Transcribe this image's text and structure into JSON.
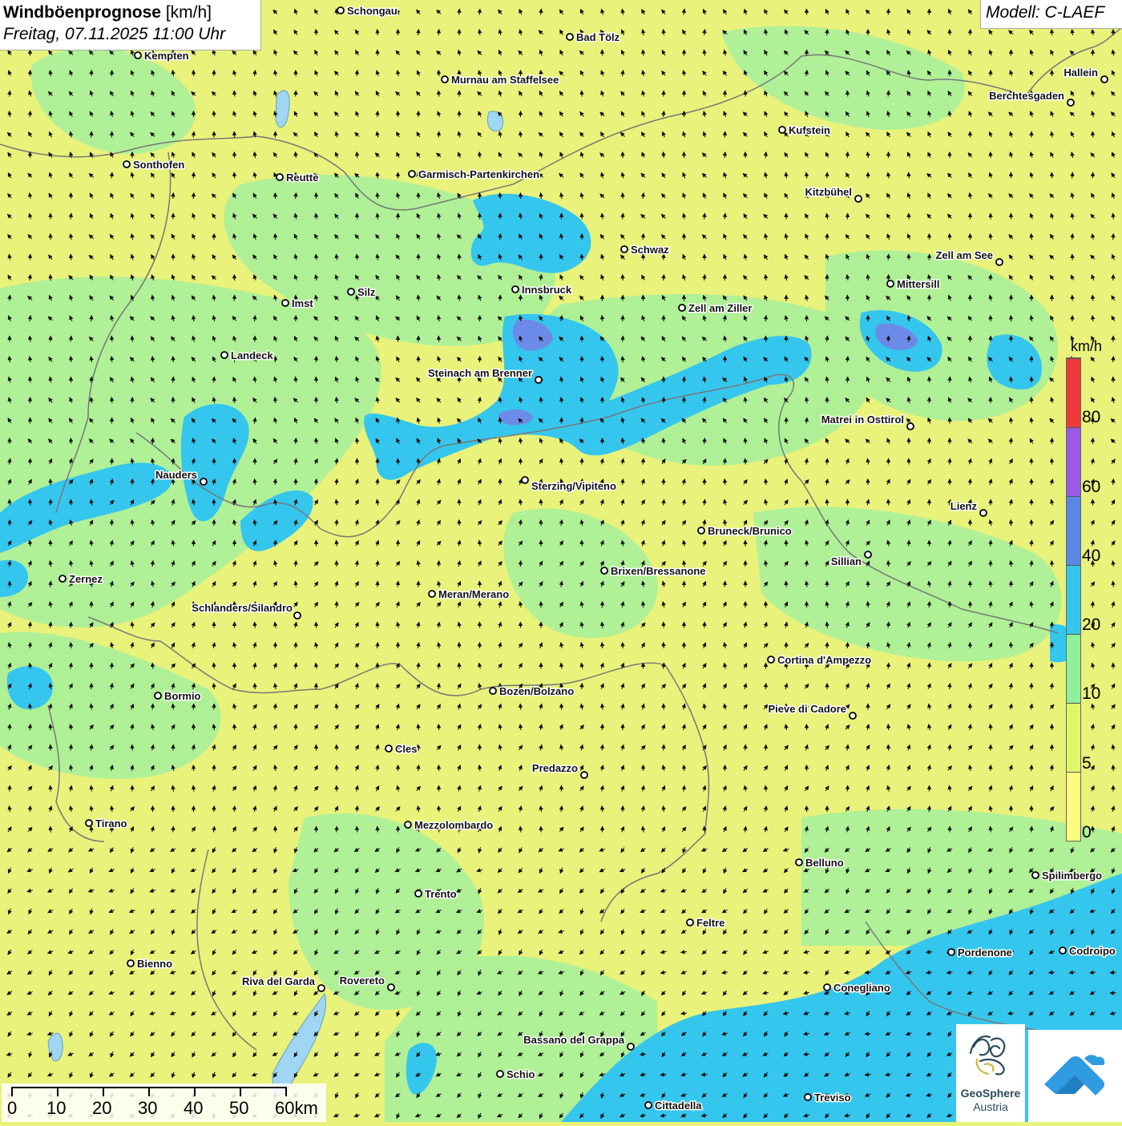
{
  "header": {
    "title": "Windböenprognose",
    "unit": "[km/h]",
    "datetime": "Freitag, 07.11.2025 11:00 Uhr",
    "model": "Modell: C-LAEF"
  },
  "legend": {
    "unit": "km/h",
    "classes": [
      {
        "color": "#fdfb80",
        "from": 0
      },
      {
        "color": "#e1f56a",
        "from": 5
      },
      {
        "color": "#8ef09a",
        "from": 10
      },
      {
        "color": "#35c6ee",
        "from": 20
      },
      {
        "color": "#5a86e6",
        "from": 40
      },
      {
        "color": "#9a5ae6",
        "from": 60
      },
      {
        "color": "#ee3a3a",
        "from": 80
      }
    ],
    "tick_labels": [
      "0",
      "5",
      "10",
      "20",
      "40",
      "60",
      "80"
    ]
  },
  "scale_bar": {
    "labels": [
      "0",
      "10",
      "20",
      "30",
      "40",
      "50",
      "60km"
    ]
  },
  "cities": [
    {
      "name": "Schongau"
    },
    {
      "name": "Bad Tölz"
    },
    {
      "name": "Kempten"
    },
    {
      "name": "Murnau am Staffelsee"
    },
    {
      "name": "Hallein"
    },
    {
      "name": "Berchtesgaden"
    },
    {
      "name": "Kufstein"
    },
    {
      "name": "Sonthofen"
    },
    {
      "name": "Reutte"
    },
    {
      "name": "Garmisch-Partenkirchen"
    },
    {
      "name": "Kitzbühel"
    },
    {
      "name": "Schwaz"
    },
    {
      "name": "Zell am See"
    },
    {
      "name": "Innsbruck"
    },
    {
      "name": "Mittersill"
    },
    {
      "name": "Imst"
    },
    {
      "name": "Silz"
    },
    {
      "name": "Zell am Ziller"
    },
    {
      "name": "Landeck"
    },
    {
      "name": "Steinach am Brenner"
    },
    {
      "name": "Matrei in Osttirol"
    },
    {
      "name": "Nauders"
    },
    {
      "name": "Sterzing/Vipiteno"
    },
    {
      "name": "Lienz"
    },
    {
      "name": "Bruneck/Brunico"
    },
    {
      "name": "Sillian"
    },
    {
      "name": "Zernez"
    },
    {
      "name": "Brixen/Bressanone"
    },
    {
      "name": "Meran/Merano"
    },
    {
      "name": "Schlanders/Silandro"
    },
    {
      "name": "Cortina d'Ampezzo"
    },
    {
      "name": "Bozen/Bolzano"
    },
    {
      "name": "Bormio"
    },
    {
      "name": "Pieve di Cadore"
    },
    {
      "name": "Cles"
    },
    {
      "name": "Predazzo"
    },
    {
      "name": "Tirano"
    },
    {
      "name": "Mezzolombardo"
    },
    {
      "name": "Belluno"
    },
    {
      "name": "Spilimbergo"
    },
    {
      "name": "Trento"
    },
    {
      "name": "Feltre"
    },
    {
      "name": "Pordenone"
    },
    {
      "name": "Codroipo"
    },
    {
      "name": "Bienno"
    },
    {
      "name": "Riva del Garda"
    },
    {
      "name": "Rovereto"
    },
    {
      "name": "Conegliano"
    },
    {
      "name": "Bassano del Grappa"
    },
    {
      "name": "Schio"
    },
    {
      "name": "Treviso"
    },
    {
      "name": "Cittadella"
    }
  ],
  "logos": {
    "geosphere_line1": "GeoSphere",
    "geosphere_line2": "Austria",
    "geosphere_icon": "geosphere-logo-icon",
    "app_icon": "warnings-app-icon"
  }
}
